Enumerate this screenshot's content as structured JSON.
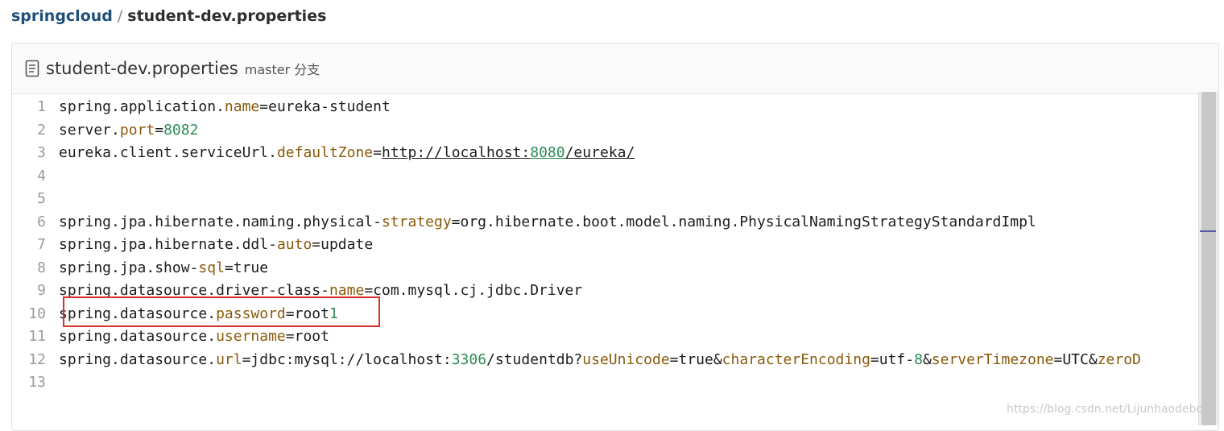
{
  "breadcrumb": {
    "repo": "springcloud",
    "separator": "/",
    "file": "student-dev.properties"
  },
  "file_header": {
    "icon": "document-icon",
    "title": "student-dev.properties",
    "branch": "master 分支"
  },
  "code": {
    "lines": [
      {
        "no": "1",
        "tokens": [
          {
            "t": "spring.application.",
            "c": "plain"
          },
          {
            "t": "name",
            "c": "key"
          },
          {
            "t": "=eureka-student",
            "c": "plain"
          }
        ]
      },
      {
        "no": "2",
        "tokens": [
          {
            "t": "server.",
            "c": "plain"
          },
          {
            "t": "port",
            "c": "key"
          },
          {
            "t": "=",
            "c": "plain"
          },
          {
            "t": "8082",
            "c": "num"
          }
        ]
      },
      {
        "no": "3",
        "tokens": [
          {
            "t": "eureka.client.serviceUrl.",
            "c": "plain"
          },
          {
            "t": "defaultZone",
            "c": "key"
          },
          {
            "t": "=",
            "c": "plain"
          },
          {
            "t": "http://localhost:",
            "c": "url"
          },
          {
            "t": "8080",
            "c": "urlnum"
          },
          {
            "t": "/eureka/",
            "c": "url"
          }
        ]
      },
      {
        "no": "4",
        "tokens": []
      },
      {
        "no": "5",
        "tokens": []
      },
      {
        "no": "6",
        "tokens": [
          {
            "t": "spring.jpa.hibernate.naming.physical-",
            "c": "plain"
          },
          {
            "t": "strategy",
            "c": "key"
          },
          {
            "t": "=org.hibernate.boot.model.naming.PhysicalNamingStrategyStandardImpl",
            "c": "plain"
          }
        ]
      },
      {
        "no": "7",
        "tokens": [
          {
            "t": "spring.jpa.hibernate.ddl-",
            "c": "plain"
          },
          {
            "t": "auto",
            "c": "key"
          },
          {
            "t": "=update",
            "c": "plain"
          }
        ]
      },
      {
        "no": "8",
        "tokens": [
          {
            "t": "spring.jpa.show-",
            "c": "plain"
          },
          {
            "t": "sql",
            "c": "key"
          },
          {
            "t": "=true",
            "c": "plain"
          }
        ]
      },
      {
        "no": "9",
        "tokens": [
          {
            "t": "spring.datasource.driver-class-",
            "c": "plain"
          },
          {
            "t": "name",
            "c": "key"
          },
          {
            "t": "=com.mysql.cj.jdbc.Driver",
            "c": "plain"
          }
        ]
      },
      {
        "no": "10",
        "tokens": [
          {
            "t": "spring.datasource.",
            "c": "plain"
          },
          {
            "t": "password",
            "c": "key"
          },
          {
            "t": "=root",
            "c": "plain"
          },
          {
            "t": "1",
            "c": "num"
          }
        ]
      },
      {
        "no": "11",
        "tokens": [
          {
            "t": "spring.datasource.",
            "c": "plain"
          },
          {
            "t": "username",
            "c": "key"
          },
          {
            "t": "=root",
            "c": "plain"
          }
        ]
      },
      {
        "no": "12",
        "tokens": [
          {
            "t": "spring.datasource.",
            "c": "plain"
          },
          {
            "t": "url",
            "c": "key"
          },
          {
            "t": "=jdbc:mysql://localhost:",
            "c": "plain"
          },
          {
            "t": "3306",
            "c": "num"
          },
          {
            "t": "/studentdb?",
            "c": "plain"
          },
          {
            "t": "useUnicode",
            "c": "key"
          },
          {
            "t": "=true&",
            "c": "plain"
          },
          {
            "t": "characterEncoding",
            "c": "key"
          },
          {
            "t": "=utf-",
            "c": "plain"
          },
          {
            "t": "8",
            "c": "num"
          },
          {
            "t": "&",
            "c": "plain"
          },
          {
            "t": "serverTimezone",
            "c": "key"
          },
          {
            "t": "=UTC&",
            "c": "plain"
          },
          {
            "t": "zeroD",
            "c": "key"
          }
        ]
      },
      {
        "no": "13",
        "tokens": []
      }
    ]
  },
  "watermark": "https://blog.csdn.net/Lijunhaodeboke",
  "colors": {
    "key": "#8a5a0a",
    "number": "#2e8b57",
    "highlight_border": "#d9302f",
    "breadcrumb_link": "#1f4f7a"
  }
}
